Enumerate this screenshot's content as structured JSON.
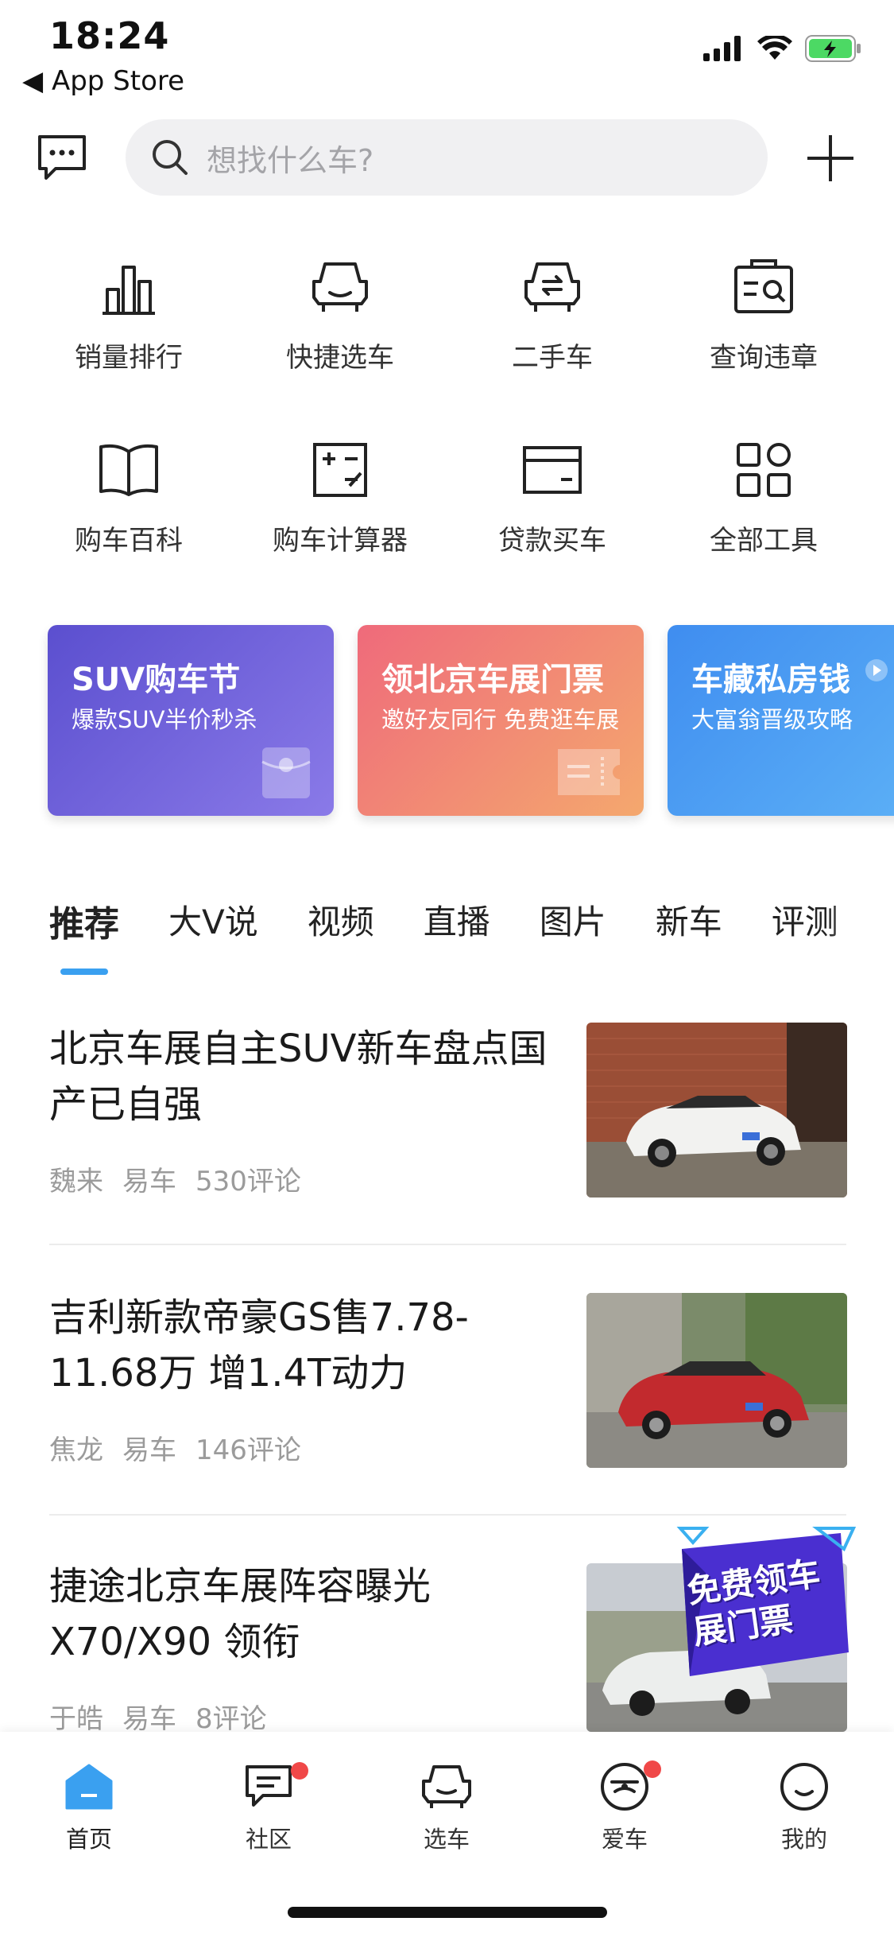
{
  "status_bar": {
    "time": "18:24",
    "back_label": "◀ App Store"
  },
  "search": {
    "placeholder": "想找什么车?"
  },
  "tools": [
    {
      "label": "销量排行",
      "icon": "bar-chart-icon"
    },
    {
      "label": "快捷选车",
      "icon": "car-icon"
    },
    {
      "label": "二手车",
      "icon": "used-car-icon"
    },
    {
      "label": "查询违章",
      "icon": "violation-search-icon"
    },
    {
      "label": "购车百科",
      "icon": "book-icon"
    },
    {
      "label": "购车计算器",
      "icon": "calculator-icon"
    },
    {
      "label": "贷款买车",
      "icon": "card-icon"
    },
    {
      "label": "全部工具",
      "icon": "grid-icon"
    }
  ],
  "promos": [
    {
      "title": "SUV购车节",
      "subtitle": "爆款SUV半价秒杀",
      "colors": [
        "#5b4fcf",
        "#8a7ae8"
      ]
    },
    {
      "title": "领北京车展门票",
      "subtitle": "邀好友同行 免费逛车展",
      "colors": [
        "#ef6a7b",
        "#f4a86e"
      ]
    },
    {
      "title": "车藏私房钱",
      "subtitle": "大富翁晋级攻略",
      "colors": [
        "#3f8df0",
        "#5cb0f6"
      ]
    }
  ],
  "tabs": [
    "推荐",
    "大V说",
    "视频",
    "直播",
    "图片",
    "新车",
    "评测"
  ],
  "news": [
    {
      "title": "北京车展自主SUV新车盘点国产已自强",
      "author": "魏来",
      "source": "易车",
      "comments": "530评论"
    },
    {
      "title": "吉利新款帝豪GS售7.78-11.68万 增1.4T动力",
      "author": "焦龙",
      "source": "易车",
      "comments": "146评论"
    },
    {
      "title": "捷途北京车展阵容曝光 X70/X90 领衔",
      "author": "于皓",
      "source": "易车",
      "comments": "8评论",
      "badge": "免费领车展门票"
    }
  ],
  "bottom_nav": [
    {
      "label": "首页",
      "icon": "home-icon"
    },
    {
      "label": "社区",
      "icon": "community-icon"
    },
    {
      "label": "选车",
      "icon": "select-car-icon"
    },
    {
      "label": "爱车",
      "icon": "my-car-icon"
    },
    {
      "label": "我的",
      "icon": "profile-icon"
    }
  ],
  "colors": {
    "accent": "#3aa0f0",
    "badge_dot": "#f04848",
    "battery": "#4cd964"
  }
}
